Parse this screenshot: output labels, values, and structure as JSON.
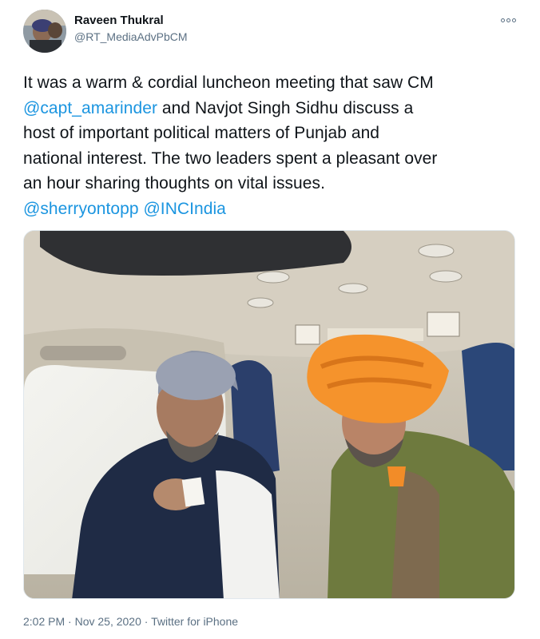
{
  "author": {
    "name": "Raveen Thukral",
    "handle": "@RT_MediaAdvPbCM"
  },
  "tweet": {
    "line1": "It was a warm & cordial luncheon meeting that saw CM",
    "mention_capt": "@capt_amarinder",
    "line2_rest": " and Navjot Singh Sidhu discuss a",
    "line3": "host of important political matters of Punjab and",
    "line4": "national interest. The two leaders spent a pleasant over",
    "line5": "an hour sharing thoughts on vital issues.",
    "mention_sherry": "@sherryontopp",
    "mention_inc": "@INCIndia"
  },
  "meta": {
    "time": "2:02 PM",
    "separator": " · ",
    "date": "Nov 25, 2020",
    "source": "Twitter for iPhone"
  },
  "colors": {
    "link": "#1b95e0",
    "secondary_text": "#5b7083",
    "primary_text": "#0f1419"
  },
  "icons": {
    "more": "more-options-icon"
  }
}
